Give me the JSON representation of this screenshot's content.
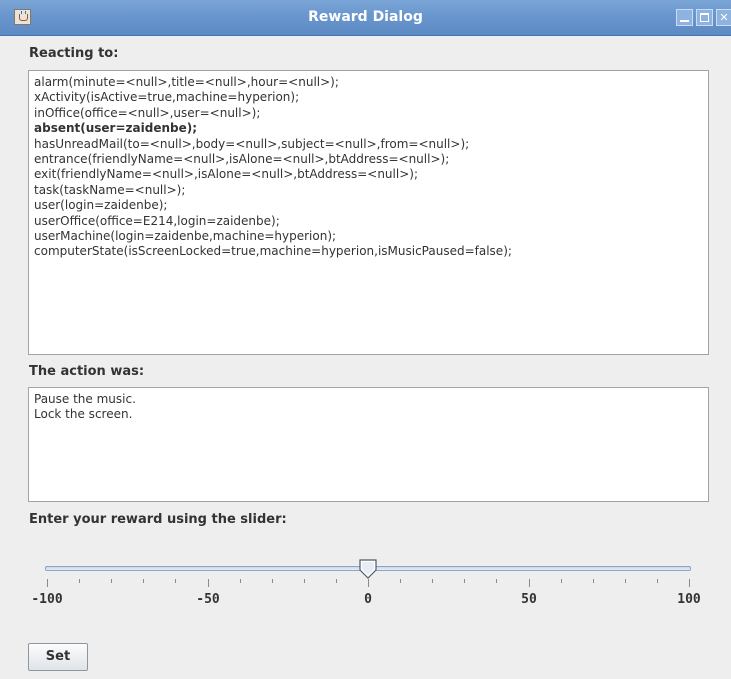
{
  "window": {
    "title": "Reward Dialog"
  },
  "reacting": {
    "label": "Reacting to:",
    "lines": [
      {
        "text": "alarm(minute=<null>,title=<null>,hour=<null>);",
        "bold": false
      },
      {
        "text": "xActivity(isActive=true,machine=hyperion);",
        "bold": false
      },
      {
        "text": "inOffice(office=<null>,user=<null>);",
        "bold": false
      },
      {
        "text": "absent(user=zaidenbe);",
        "bold": true
      },
      {
        "text": "hasUnreadMail(to=<null>,body=<null>,subject=<null>,from=<null>);",
        "bold": false
      },
      {
        "text": "entrance(friendlyName=<null>,isAlone=<null>,btAddress=<null>);",
        "bold": false
      },
      {
        "text": "exit(friendlyName=<null>,isAlone=<null>,btAddress=<null>);",
        "bold": false
      },
      {
        "text": "task(taskName=<null>);",
        "bold": false
      },
      {
        "text": "user(login=zaidenbe);",
        "bold": false
      },
      {
        "text": "userOffice(office=E214,login=zaidenbe);",
        "bold": false
      },
      {
        "text": "userMachine(login=zaidenbe,machine=hyperion);",
        "bold": false
      },
      {
        "text": "computerState(isScreenLocked=true,machine=hyperion,isMusicPaused=false);",
        "bold": false
      }
    ]
  },
  "action": {
    "label": "The action was:",
    "lines": [
      "Pause the music.",
      "Lock the screen."
    ]
  },
  "reward": {
    "label": "Enter your reward using the slider:",
    "min": -100,
    "max": 100,
    "value": 0,
    "tick_labels": [
      "-100",
      "-50",
      "0",
      "50",
      "100"
    ]
  },
  "buttons": {
    "set_label": "Set"
  },
  "colors": {
    "titlebar": "#6b97cf",
    "background": "#eeeeee",
    "text": "#333333"
  }
}
